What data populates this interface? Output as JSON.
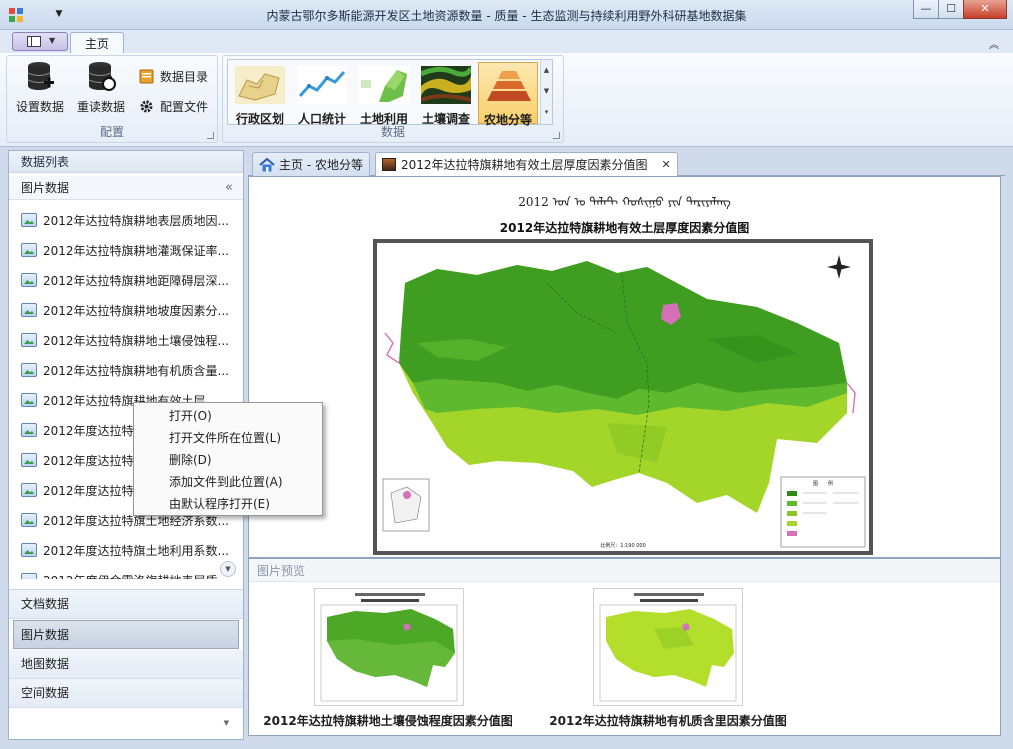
{
  "window": {
    "title": "内蒙古鄂尔多斯能源开发区土地资源数量 - 质量 - 生态监测与持续利用野外科研基地数据集",
    "minimize_glyph": "—",
    "maximize_glyph": "☐",
    "close_glyph": "✕",
    "qa_dropdown_glyph": "▼"
  },
  "ribbon": {
    "tabs": [
      {
        "label": "主页"
      }
    ],
    "minimize_glyph": "︽",
    "config_group": {
      "label": "配置",
      "set_data": "设置数据",
      "reload_data": "重读数据",
      "data_catalog": "数据目录",
      "config_file": "配置文件"
    },
    "data_group": {
      "label": "数据",
      "items": [
        {
          "label": "行政区划",
          "icon": "admin-region-icon"
        },
        {
          "label": "人口统计",
          "icon": "population-chart-icon"
        },
        {
          "label": "土地利用",
          "icon": "land-use-icon"
        },
        {
          "label": "土壤调查",
          "icon": "soil-survey-icon"
        },
        {
          "label": "农地分等",
          "icon": "farmland-grading-icon"
        }
      ],
      "scroll_up": "▲",
      "scroll_down": "▼",
      "more": "▾"
    }
  },
  "left_panel": {
    "title": "数据列表",
    "group_title": "图片数据",
    "collapse_glyph": "«",
    "items": [
      "2012年达拉特旗耕地表层质地因...",
      "2012年达拉特旗耕地灌溉保证率...",
      "2012年达拉特旗耕地距障碍层深...",
      "2012年达拉特旗耕地坡度因素分...",
      "2012年达拉特旗耕地土壤侵蚀程...",
      "2012年达拉特旗耕地有机质含量...",
      "2012年达拉特旗耕地有效土层",
      "2012年度达拉特旗",
      "2012年度达拉特旗",
      "2012年度达拉特旗",
      "2012年度达拉特旗土地经济系数...",
      "2012年度达拉特旗土地利用系数...",
      "2012年度伊金霍洛旗耕地表层质"
    ],
    "scroll_glyph": "▼",
    "nav": [
      {
        "label": "文档数据",
        "active": false
      },
      {
        "label": "图片数据",
        "active": true
      },
      {
        "label": "地图数据",
        "active": false
      },
      {
        "label": "空间数据",
        "active": false
      }
    ],
    "bottom_glyph": "▼"
  },
  "doc_tabs": [
    {
      "label": "主页 - 农地分等"
    },
    {
      "label": "2012年达拉特旗耕地有效土层厚度因素分值图",
      "close": "✕"
    }
  ],
  "map": {
    "title": "2012年达拉特旗耕地有效土层厚度因素分值图",
    "mongol_title": "2012 ᠣᠨ ᠤ ᠳᠠᠯᠠᠲ ᠬᠣᠰᠢᠭᠤ ᠶᠢᠨ ᠲᠠᠷᠢᠶᠠᠯᠠᠩ",
    "scale": "比例尺：1:190 000",
    "legend_title": "图　　例"
  },
  "preview": {
    "title": "图片预览",
    "items": [
      {
        "caption": "2012年达拉特旗耕地土壤侵蚀程度因素分值图"
      },
      {
        "caption": "2012年达拉特旗耕地有机质含里因素分值图"
      }
    ]
  },
  "context_menu": {
    "items": [
      "打开(O)",
      "打开文件所在位置(L)",
      "删除(D)",
      "添加文件到此位置(A)",
      "由默认程序打开(E)"
    ]
  },
  "colors": {
    "map_dark_green": "#3f9e22",
    "map_mid_green": "#5fb92e",
    "map_light_green": "#a4d62a",
    "accent_pink": "#d56fb8"
  }
}
